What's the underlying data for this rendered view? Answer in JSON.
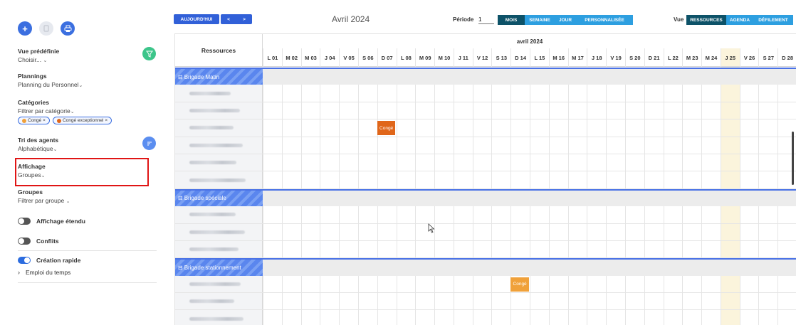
{
  "sidebar": {
    "vue_predefinie": {
      "title": "Vue prédéfinie",
      "value": "Choisir..."
    },
    "plannings": {
      "title": "Plannings",
      "value": "Planning du Personnel"
    },
    "categories": {
      "title": "Catégories",
      "value": "Filtrer par catégorie",
      "chips": [
        {
          "label": "Congé",
          "color": "#f0a13a"
        },
        {
          "label": "Congé exceptionnel",
          "color": "#e0661a"
        }
      ]
    },
    "tri": {
      "title": "Tri des agents",
      "value": "Alphabétique"
    },
    "affichage": {
      "title": "Affichage",
      "value": "Groupes"
    },
    "groupes": {
      "title": "Groupes",
      "value": "Filtrer par groupe"
    },
    "toggles": [
      {
        "label": "Affichage étendu",
        "on": false
      },
      {
        "label": "Conflits",
        "on": false
      },
      {
        "label": "Création rapide",
        "on": true
      }
    ],
    "emploi": "Emploi du temps"
  },
  "toolbar": {
    "today": "AUJOURD'HUI",
    "prev": "<",
    "next": ">",
    "month_title": "Avril 2024",
    "periode_label": "Période",
    "periode_value": "1",
    "period_modes": [
      "MOIS",
      "SEMAINE",
      "JOUR",
      "PERSONNALISÉE"
    ],
    "active_period": "MOIS",
    "vue_label": "Vue",
    "view_modes": [
      "RESSOURCES",
      "AGENDA",
      "DÉFILEMENT"
    ],
    "active_view": "RESSOURCES"
  },
  "grid": {
    "resources_header": "Ressources",
    "month_label": "avril 2024",
    "days": [
      "L 01",
      "M 02",
      "M 03",
      "J 04",
      "V 05",
      "S 06",
      "D 07",
      "L 08",
      "M 09",
      "M 10",
      "J 11",
      "V 12",
      "S 13",
      "D 14",
      "L 15",
      "M 16",
      "M 17",
      "J 18",
      "V 19",
      "S 20",
      "D 21",
      "L 22",
      "M 23",
      "M 24",
      "J 25",
      "V 26",
      "S 27",
      "D 28"
    ],
    "today_index": 24,
    "groups": [
      {
        "label": "Brigade Matin",
        "rows": 6
      },
      {
        "label": "Brigade spéciale",
        "rows": 3
      },
      {
        "label": "Brigade stationnement",
        "rows": 3
      }
    ],
    "events": [
      {
        "label": "Congé",
        "group": 0,
        "row": 2,
        "day": 6,
        "color": "#e0661a"
      },
      {
        "label": "Congé",
        "group": 2,
        "row": 0,
        "day": 13,
        "color": "#f0a13a"
      }
    ]
  }
}
